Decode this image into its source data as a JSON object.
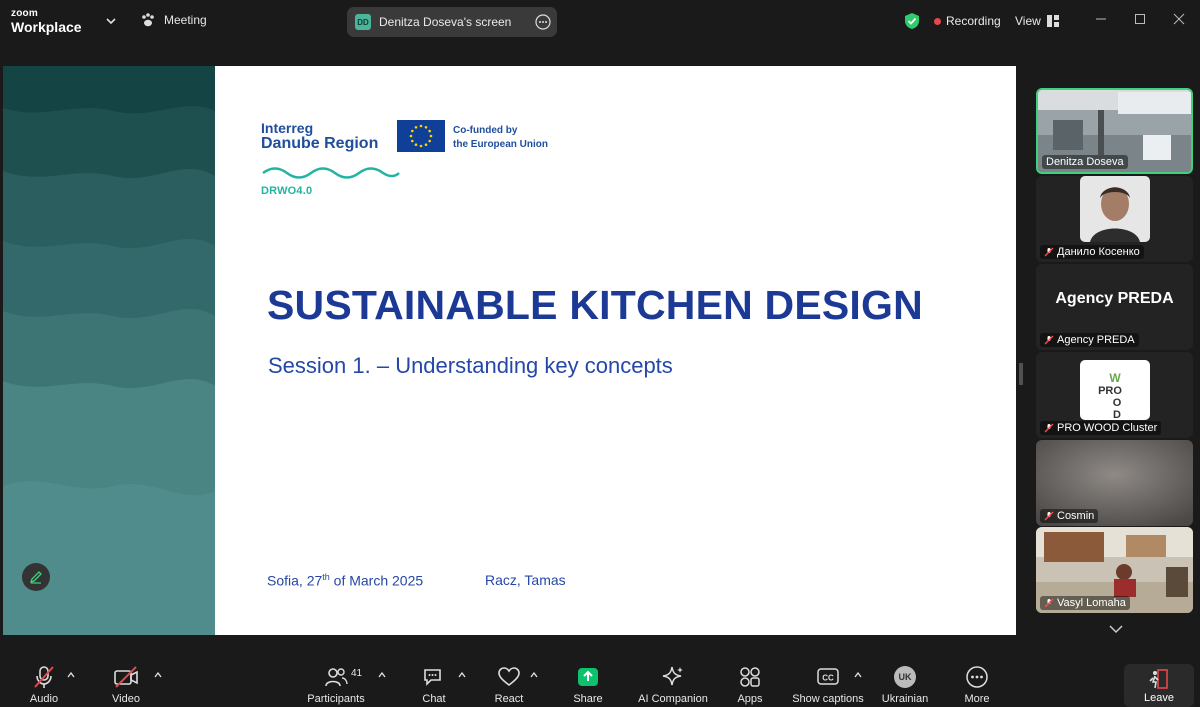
{
  "app": {
    "brand_line1": "zoom",
    "brand_line2": "Workplace",
    "meeting_label": "Meeting"
  },
  "screen_share": {
    "initials": "DD",
    "label": "Denitza Doseva's screen"
  },
  "recording": {
    "label": "Recording",
    "color": "#e5484d"
  },
  "view": {
    "label": "View"
  },
  "slide": {
    "logo_line1": "Interreg",
    "logo_line2": "Danube Region",
    "cofunded_line1": "Co-funded by",
    "cofunded_line2": "the European Union",
    "project": "DRWO4.0",
    "title": "SUSTAINABLE KITCHEN DESIGN",
    "subtitle": "Session 1. – Understanding key concepts",
    "date_prefix": "Sofia, 27",
    "date_sup": "th",
    "date_suffix": " of March 2025",
    "author": "Racz, Tamas",
    "title_color": "#1c3a95"
  },
  "participants": [
    {
      "name": "Denitza Doseva",
      "muted": false,
      "active": true
    },
    {
      "name": "Данило Косенко",
      "muted": true,
      "active": false
    },
    {
      "name": "Agency PREDA",
      "display": "Agency PREDA",
      "muted": true,
      "active": false
    },
    {
      "name": "PRO WOOD Cluster",
      "muted": true,
      "active": false
    },
    {
      "name": "Cosmin",
      "muted": true,
      "active": false
    },
    {
      "name": "Vasyl Lomaha",
      "muted": true,
      "active": false
    }
  ],
  "toolbar": {
    "audio": "Audio",
    "video": "Video",
    "participants": "Participants",
    "participants_count": "41",
    "chat": "Chat",
    "react": "React",
    "share": "Share",
    "ai_companion": "AI Companion",
    "apps": "Apps",
    "captions": "Show captions",
    "cc": "CC",
    "language_initials": "UK",
    "language": "Ukrainian",
    "more": "More",
    "leave": "Leave"
  },
  "icons": [
    "paw-icon",
    "chevron-down-icon",
    "more-icon",
    "shield-check-icon",
    "grid-icon",
    "minimize-icon",
    "maximize-icon",
    "close-icon",
    "mic-off-icon",
    "video-off-icon",
    "participants-icon",
    "chat-icon",
    "heart-icon",
    "share-arrow-icon",
    "sparkle-icon",
    "apps-icon",
    "captions-icon",
    "ellipsis-icon",
    "leave-icon",
    "pen-icon"
  ],
  "colors": {
    "accent_green": "#3fd17d",
    "share_green": "#0ec26d",
    "slide_teal": "#2f6b6a"
  }
}
